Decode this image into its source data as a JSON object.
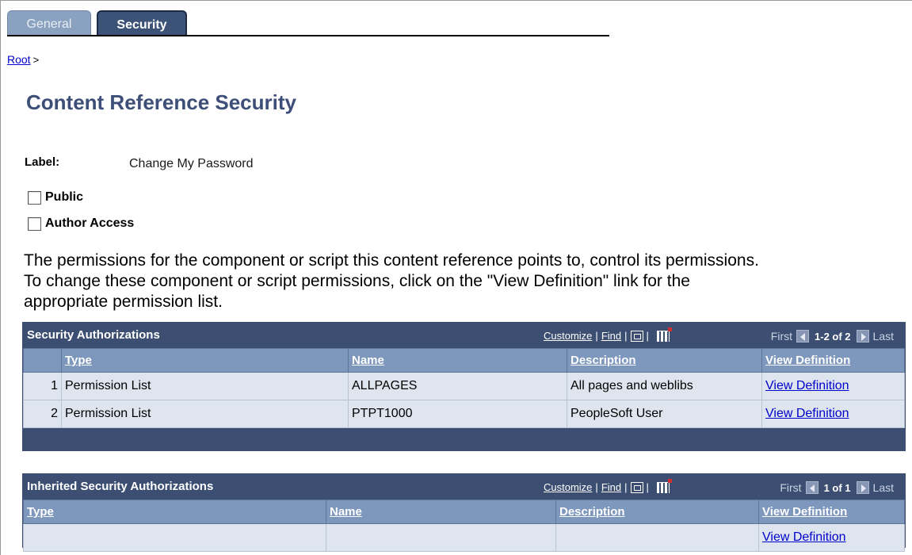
{
  "tabs": [
    {
      "label": "General"
    },
    {
      "label": "Security"
    }
  ],
  "breadcrumb": {
    "root": "Root",
    "separator": ">"
  },
  "page": {
    "title": "Content Reference Security"
  },
  "label_field": {
    "key": "Label:",
    "value": "Change My Password"
  },
  "checkboxes": {
    "public": {
      "label": "Public",
      "checked": false
    },
    "author_access": {
      "label": "Author Access",
      "checked": false
    }
  },
  "instructions": "The permissions for the component or script this content reference points to, control its permissions. To change these component or script permissions, click on the \"View Definition\" link for the appropriate permission list.",
  "grid_controls": {
    "customize": "Customize",
    "find": "Find",
    "pipe": "|",
    "first": "First",
    "last": "Last"
  },
  "security_grid": {
    "title": "Security Authorizations",
    "range": "1-2 of 2",
    "columns": [
      "Type",
      "Name",
      "Description",
      "View Definition"
    ],
    "rows": [
      {
        "num": "1",
        "type": "Permission List",
        "name": "ALLPAGES",
        "description": "All pages and weblibs",
        "link": "View Definition"
      },
      {
        "num": "2",
        "type": "Permission List",
        "name": "PTPT1000",
        "description": "PeopleSoft User",
        "link": "View Definition"
      }
    ]
  },
  "inherited_grid": {
    "title": "Inherited Security Authorizations",
    "range": "1 of 1",
    "columns": [
      "Type",
      "Name",
      "Description",
      "View Definition"
    ],
    "rows": [
      {
        "type": "",
        "name": "",
        "description": "",
        "link": "View Definition"
      }
    ]
  },
  "colors": {
    "grid_header": "#3c4f72",
    "column_header": "#7e97bd",
    "row_bg": "#dfe5ee",
    "title": "#3d4f78",
    "link": "#0000cc"
  }
}
